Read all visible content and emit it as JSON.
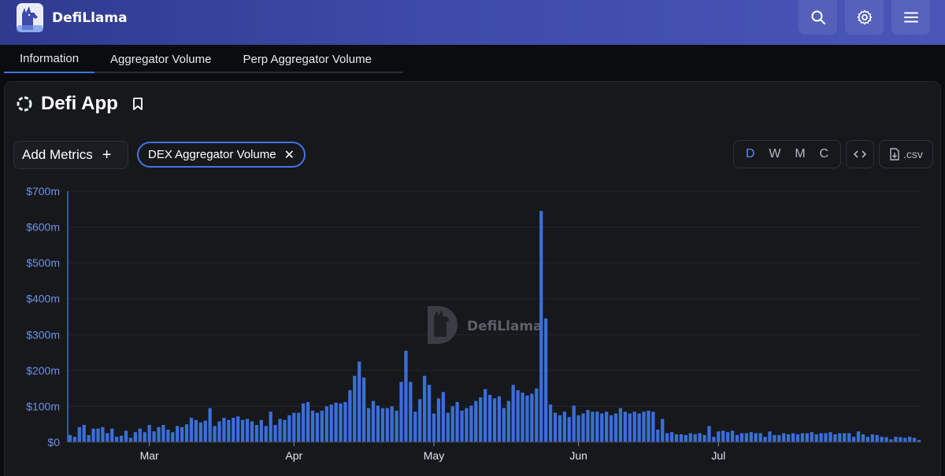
{
  "header": {
    "brand": "DefiLlama",
    "buttons": [
      {
        "name": "search",
        "icon": "search-icon"
      },
      {
        "name": "settings",
        "icon": "gear-icon"
      },
      {
        "name": "menu",
        "icon": "hamburger-menu-icon"
      }
    ]
  },
  "tabs": [
    {
      "label": "Information",
      "active": true
    },
    {
      "label": "Aggregator Volume",
      "active": false
    },
    {
      "label": "Perp Aggregator Volume",
      "active": false
    }
  ],
  "protocol": {
    "title": "Defi App",
    "icon": "protocol-ring-icon",
    "bookmark_icon": "bookmark-icon"
  },
  "controls": {
    "add_metrics_label": "Add Metrics",
    "add_icon": "+",
    "selected_metric": "DEX Aggregator Volume",
    "remove_icon": "✕",
    "periods": [
      "D",
      "W",
      "M",
      "C"
    ],
    "active_period": "D",
    "embed_icon": "code-icon",
    "csv_label": ".csv",
    "csv_icon": "download-file-icon"
  },
  "colors": {
    "accent": "#3f74e8",
    "bar": "#3a6fd8",
    "header_bg": "#3d4aa8"
  },
  "chart_data": {
    "type": "bar",
    "watermark": "DefiLlama",
    "y_ticks": [
      "$0",
      "$100m",
      "$200m",
      "$300m",
      "$400m",
      "$500m",
      "$600m",
      "$700m"
    ],
    "ylim": [
      0,
      700
    ],
    "x_ticks": [
      {
        "label": "Mar",
        "index": 17
      },
      {
        "label": "Apr",
        "index": 48
      },
      {
        "label": "May",
        "index": 78
      },
      {
        "label": "Jun",
        "index": 109
      },
      {
        "label": "Jul",
        "index": 139
      }
    ],
    "series": [
      {
        "values": [
          20,
          15,
          42,
          48,
          20,
          38,
          38,
          42,
          25,
          38,
          15,
          18,
          32,
          12,
          28,
          38,
          28,
          48,
          30,
          42,
          48,
          35,
          28,
          45,
          42,
          50,
          68,
          62,
          55,
          60,
          95,
          45,
          58,
          68,
          62,
          68,
          72,
          62,
          65,
          58,
          48,
          62,
          45,
          85,
          48,
          65,
          62,
          75,
          82,
          82,
          108,
          112,
          88,
          82,
          88,
          100,
          105,
          110,
          108,
          112,
          145,
          185,
          225,
          180,
          95,
          115,
          102,
          95,
          95,
          100,
          88,
          168,
          255,
          168,
          85,
          120,
          185,
          160,
          80,
          122,
          140,
          82,
          100,
          112,
          88,
          95,
          102,
          115,
          125,
          148,
          132,
          122,
          128,
          95,
          115,
          160,
          145,
          138,
          130,
          135,
          150,
          645,
          345,
          105,
          82,
          75,
          85,
          70,
          102,
          75,
          80,
          90,
          85,
          85,
          80,
          85,
          75,
          80,
          95,
          85,
          80,
          85,
          80,
          85,
          88,
          85,
          35,
          65,
          25,
          28,
          22,
          22,
          20,
          25,
          22,
          25,
          20,
          45,
          15,
          30,
          32,
          28,
          32,
          20,
          25,
          25,
          28,
          25,
          25,
          15,
          30,
          20,
          20,
          25,
          22,
          25,
          22,
          25,
          25,
          28,
          22,
          25,
          25,
          28,
          22,
          25,
          25,
          25,
          15,
          30,
          22,
          15,
          22,
          20,
          15,
          14,
          8,
          15,
          14,
          12,
          15,
          12,
          6
        ]
      }
    ]
  }
}
